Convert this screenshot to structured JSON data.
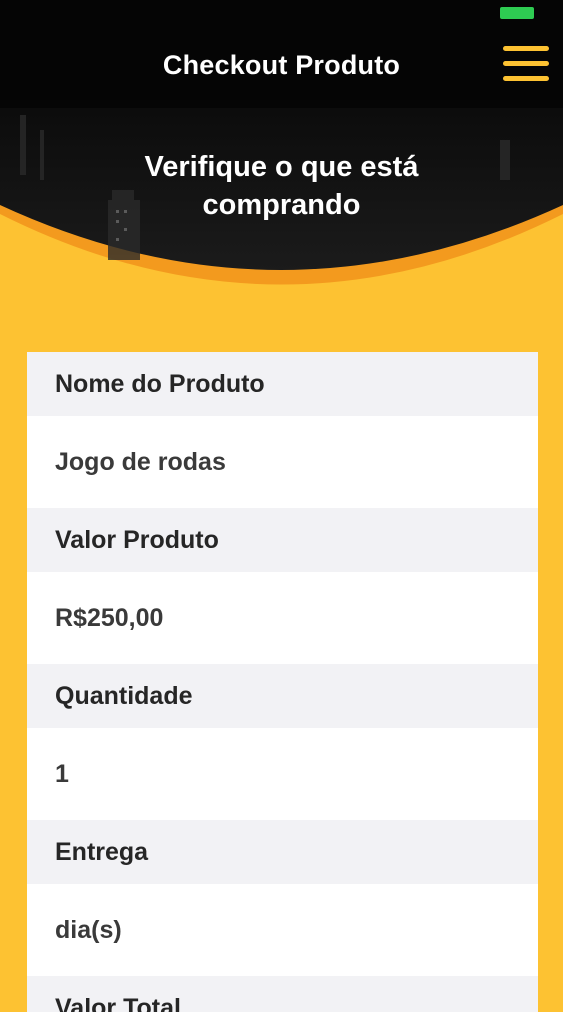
{
  "header": {
    "title": "Checkout Produto",
    "menu_icon": "hamburger-menu-icon",
    "battery_color": "#2ECC52",
    "accent_color": "#FDC232"
  },
  "hero": {
    "line1": "Verifique o que está",
    "line2": "comprando"
  },
  "card": {
    "rows": [
      {
        "label": "Nome do Produto",
        "value": "Jogo de rodas"
      },
      {
        "label": "Valor Produto",
        "value": "R$250,00"
      },
      {
        "label": "Quantidade",
        "value": "1"
      },
      {
        "label": "Entrega",
        "value": "dia(s)"
      },
      {
        "label": "Valor Total",
        "value": ""
      }
    ]
  }
}
